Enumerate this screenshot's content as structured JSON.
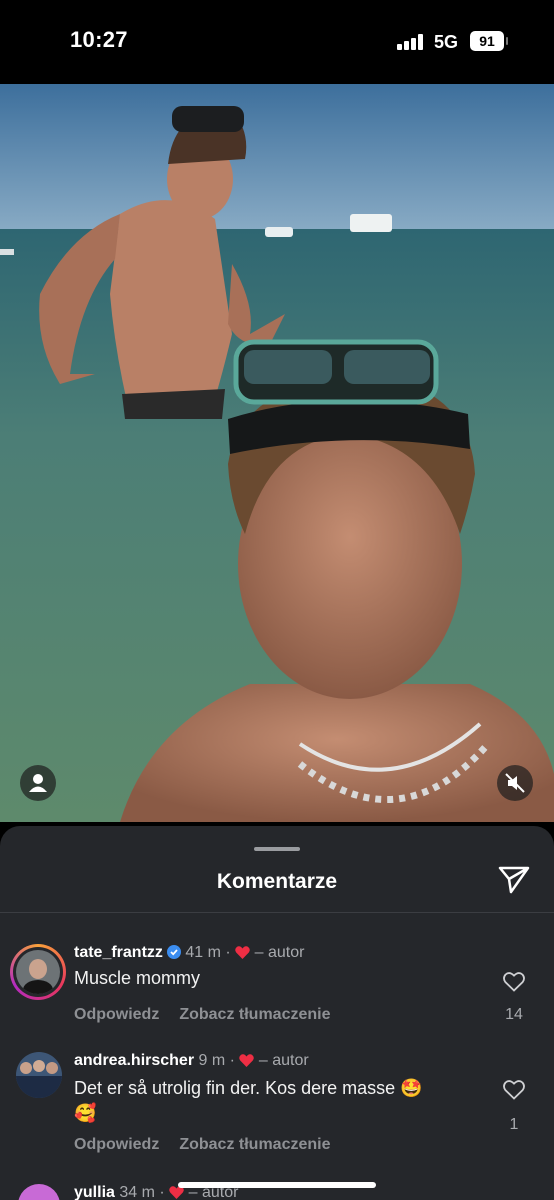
{
  "status_bar": {
    "time": "10:27",
    "network": "5G",
    "battery": "91"
  },
  "photo": {
    "description_icon": "user-tag-icon",
    "mute_icon": "speaker-muted-icon"
  },
  "comments_sheet": {
    "title": "Komentarze",
    "comments": [
      {
        "username": "tate_frantzz",
        "verified": true,
        "time": "41 m",
        "liked_by_author": "– autor",
        "text": "Muscle mommy",
        "reply_label": "Odpowiedz",
        "translate_label": "Zobacz tłumaczenie",
        "likes": "14"
      },
      {
        "username": "andrea.hirscher",
        "verified": false,
        "time": "9 m",
        "liked_by_author": "– autor",
        "text": "Det er så utrolig fin der. Kos dere masse 🤩",
        "text_line2": "🥰",
        "reply_label": "Odpowiedz",
        "translate_label": "Zobacz tłumaczenie",
        "likes": "1"
      },
      {
        "username": "yullia",
        "time": "34 m",
        "liked_by_author": "– autor"
      }
    ]
  }
}
